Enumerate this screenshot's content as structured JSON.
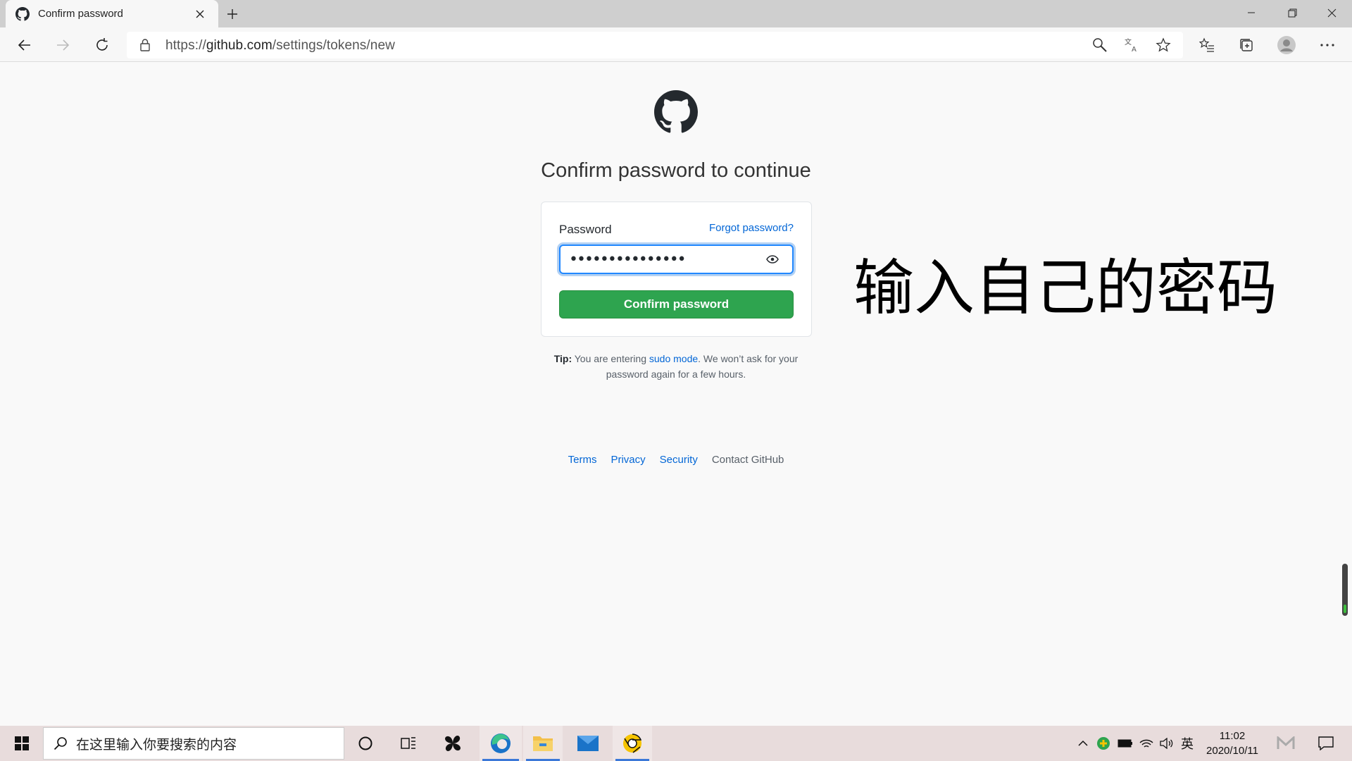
{
  "browser": {
    "tab_title": "Confirm password",
    "url_prefix": "https://",
    "url_host": "github.com",
    "url_path": "/settings/tokens/new"
  },
  "page": {
    "heading": "Confirm password to continue",
    "password_label": "Password",
    "forgot_link": "Forgot password?",
    "password_value": "•••••••••••••••",
    "submit_label": "Confirm password",
    "tip_prefix": "Tip:",
    "tip_text_1": " You are entering ",
    "tip_link": "sudo mode",
    "tip_text_2": ". We won’t ask for your password again for a few hours.",
    "footer_links": [
      "Terms",
      "Privacy",
      "Security",
      "Contact GitHub"
    ]
  },
  "annotation": "输入自己的密码",
  "taskbar": {
    "search_placeholder": "在这里输入你要搜索的内容",
    "ime": "英",
    "time": "11:02",
    "date": "2020/10/11"
  },
  "colors": {
    "primary_button": "#2ea44f",
    "link": "#0366d6",
    "focus_ring": "#2188ff"
  }
}
